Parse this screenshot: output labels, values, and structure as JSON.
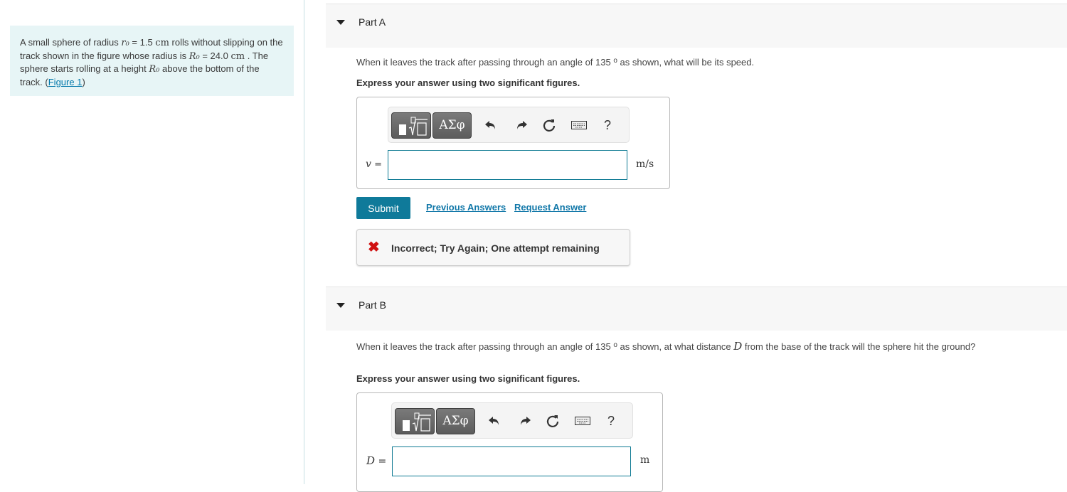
{
  "intro": {
    "text_1": "A small sphere of radius ",
    "r0_symbol": "r₀",
    "text_2": " = 1.5 ",
    "unit_cm_1": "cm",
    "text_3": " rolls without slipping on the track shown in the figure whose radius is ",
    "R0_symbol": "R₀",
    "text_4": " = 24.0 ",
    "unit_cm_2": "cm",
    "text_5": " . The sphere starts rolling at a height ",
    "R0_symbol_2": "R₀",
    "text_6": " above the bottom of the track. (",
    "figure_link": "Figure 1",
    "text_7": ")"
  },
  "parts": [
    {
      "title": "Part A",
      "question_1": "When it leaves the track after passing through an angle of 135 ",
      "degree": "o",
      "question_2": " as shown, what will be its speed.",
      "instruction": "Express your answer using two significant figures.",
      "toolbar": {
        "greek_label": "ΑΣφ",
        "undo_icon": "undo-icon",
        "redo_icon": "redo-icon",
        "reset_icon": "reset-icon",
        "keyboard_icon": "keyboard-icon",
        "help_label": "?"
      },
      "variable": "v",
      "equals": "=",
      "input_value": "",
      "unit": "m/s",
      "submit_label": "Submit",
      "previous_answers_label": "Previous Answers",
      "request_answer_label": "Request Answer",
      "feedback": {
        "status": "incorrect",
        "icon": "✖",
        "message": "Incorrect; Try Again; One attempt remaining"
      }
    },
    {
      "title": "Part B",
      "question_1": "When it leaves the track after passing through an angle of 135 ",
      "degree": "o",
      "question_2": " as shown, at what distance ",
      "var_D": "D",
      "question_3": " from the base of the track will the sphere hit the ground?",
      "instruction": "Express your answer using two significant figures.",
      "toolbar": {
        "greek_label": "ΑΣφ",
        "help_label": "?"
      },
      "variable": "D",
      "equals": "=",
      "input_value": "",
      "unit": "m"
    }
  ],
  "colors": {
    "accent": "#0f7a9a",
    "link": "#1077a8",
    "error": "#d01111",
    "intro_bg": "#e7f5f6"
  }
}
